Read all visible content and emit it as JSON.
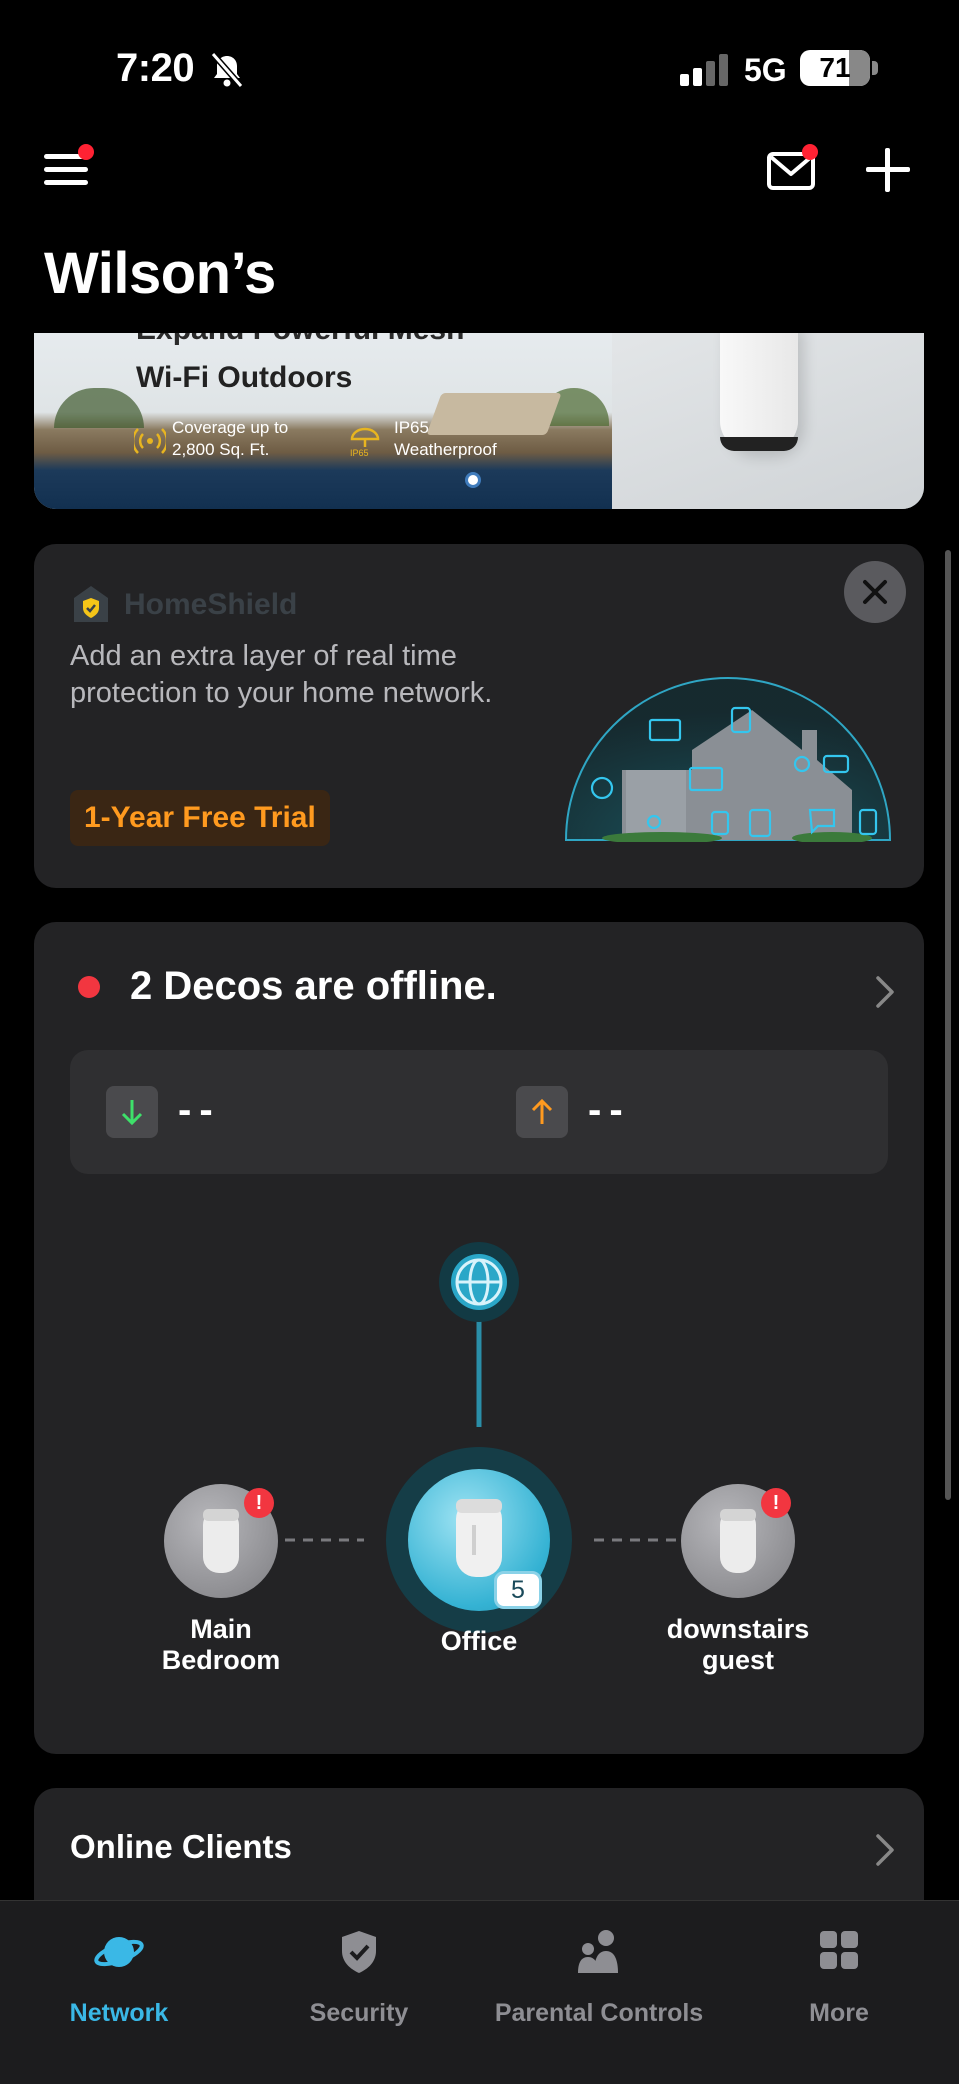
{
  "status_bar": {
    "time": "7:20",
    "network": "5G",
    "battery": "71"
  },
  "header": {
    "title": "Wilson’s"
  },
  "banner": {
    "headline_partial": "Expand Powerful Mesh",
    "headline": "Wi-Fi Outdoors",
    "feature_1": "Coverage up to\n2,800 Sq. Ft.",
    "feature_2": "IP65\nWeatherproof",
    "feature_2_icon_text": "IP65"
  },
  "homeshield": {
    "brand": "HomeShield",
    "description": "Add an extra layer of real time protection to your home network.",
    "trial_label": "1-Year Free Trial"
  },
  "network_status": {
    "message": "2 Decos are offline.",
    "download": "--",
    "upload": "--"
  },
  "topology": {
    "main_node": {
      "label": "Office",
      "clients": "5"
    },
    "satellites": [
      {
        "label": "Main\nBedroom",
        "alert": "!"
      },
      {
        "label": "downstairs\nguest",
        "alert": "!"
      }
    ]
  },
  "online_clients": {
    "title": "Online Clients"
  },
  "tabs": [
    {
      "label": "Network",
      "active": true
    },
    {
      "label": "Security",
      "active": false
    },
    {
      "label": "Parental Controls",
      "active": false
    },
    {
      "label": "More",
      "active": false
    }
  ],
  "colors": {
    "accent": "#3ab8e6",
    "alert": "#f23640",
    "trial": "#ff9a1f"
  }
}
